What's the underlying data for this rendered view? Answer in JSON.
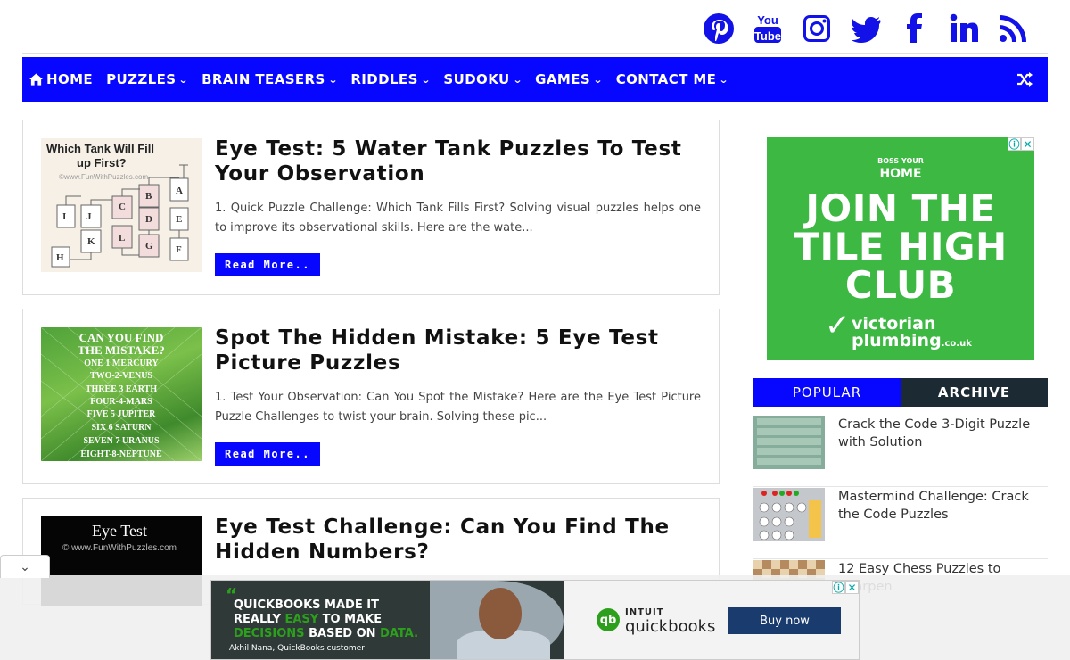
{
  "social": [
    "pinterest-icon",
    "youtube-icon",
    "instagram-icon",
    "twitter-icon",
    "facebook-icon",
    "linkedin-icon",
    "rss-icon"
  ],
  "nav": {
    "items": [
      {
        "label": "HOME",
        "icon": "home-icon"
      },
      {
        "label": "PUZZLES",
        "dropdown": true
      },
      {
        "label": "BRAIN TEASERS",
        "dropdown": true
      },
      {
        "label": "RIDDLES",
        "dropdown": true
      },
      {
        "label": "SUDOKU",
        "dropdown": true
      },
      {
        "label": "GAMES",
        "dropdown": true
      },
      {
        "label": "CONTACT ME",
        "dropdown": true
      }
    ],
    "shuffle_icon": "shuffle-icon",
    "chev": "⌄"
  },
  "posts": [
    {
      "title": "Eye Test: 5 Water Tank Puzzles To Test Your Observation",
      "excerpt": "1. Quick Puzzle Challenge: Which Tank Fills First? Solving visual puzzles helps one to improve its observational skills. Here are the wate...",
      "read_more": "Read More..",
      "thumb_text": "Which Tank Will Fill up First?",
      "thumb_url": "©www.FunWithPuzzles.com"
    },
    {
      "title": "Spot The Hidden Mistake: 5 Eye Test Picture Puzzles",
      "excerpt": "1. Test Your Observation: Can You Spot the Mistake? Here are the Eye Test Picture Puzzle Challenges to twist your brain. Solving these pic...",
      "read_more": "Read More..",
      "thumb_lines": [
        "CAN YOU FIND",
        "THE MISTAKE?",
        "ONE 1 MERCURY",
        "TWO-2-VENUS",
        "THREE 3 EARTH",
        "FOUR-4-MARS",
        "FIVE 5 JUPITER",
        "SIX 6 SATURN",
        "SEVEN 7 URANUS",
        "EIGHT-8-NEPTUNE"
      ]
    },
    {
      "title": "Eye Test Challenge: Can You Find The Hidden Numbers?",
      "thumb_text": "Eye Test",
      "thumb_url": "© www.FunWithPuzzles.com"
    }
  ],
  "side_ad": {
    "brand_top": "BOSS YOUR",
    "brand_main": "HOME",
    "headline": [
      "JOIN THE",
      "TILE HIGH",
      "CLUB"
    ],
    "logo_line1": "victorian",
    "logo_line2": "plumbing",
    "logo_suffix": ".co.uk",
    "info": "ⓘ",
    "close": "✕"
  },
  "tabs": {
    "popular": "POPULAR",
    "archive": "ARCHIVE"
  },
  "popular": [
    {
      "title": "Crack the Code 3-Digit Puzzle with Solution"
    },
    {
      "title": "Mastermind Challenge: Crack the Code Puzzles"
    },
    {
      "title": "12 Easy Chess Puzzles to Sharpen"
    }
  ],
  "bottom_ad": {
    "quote": "“",
    "headline_1": "QUICKBOOKS MADE IT",
    "headline_2a": "REALLY ",
    "headline_2b": "EASY",
    "headline_2c": " TO MAKE",
    "headline_3a": "DECISIONS",
    "headline_3b": " BASED ON ",
    "headline_3c": "DATA.",
    "attribution": "Akhil Nana, QuickBooks customer",
    "brand_small": "INTUIT",
    "brand": "quickbooks",
    "logo": "qb",
    "cta": "Buy now",
    "info": "ⓘ",
    "close": "✕"
  },
  "collapse_icon": "chevron-down-icon",
  "collapse_glyph": "⌄"
}
